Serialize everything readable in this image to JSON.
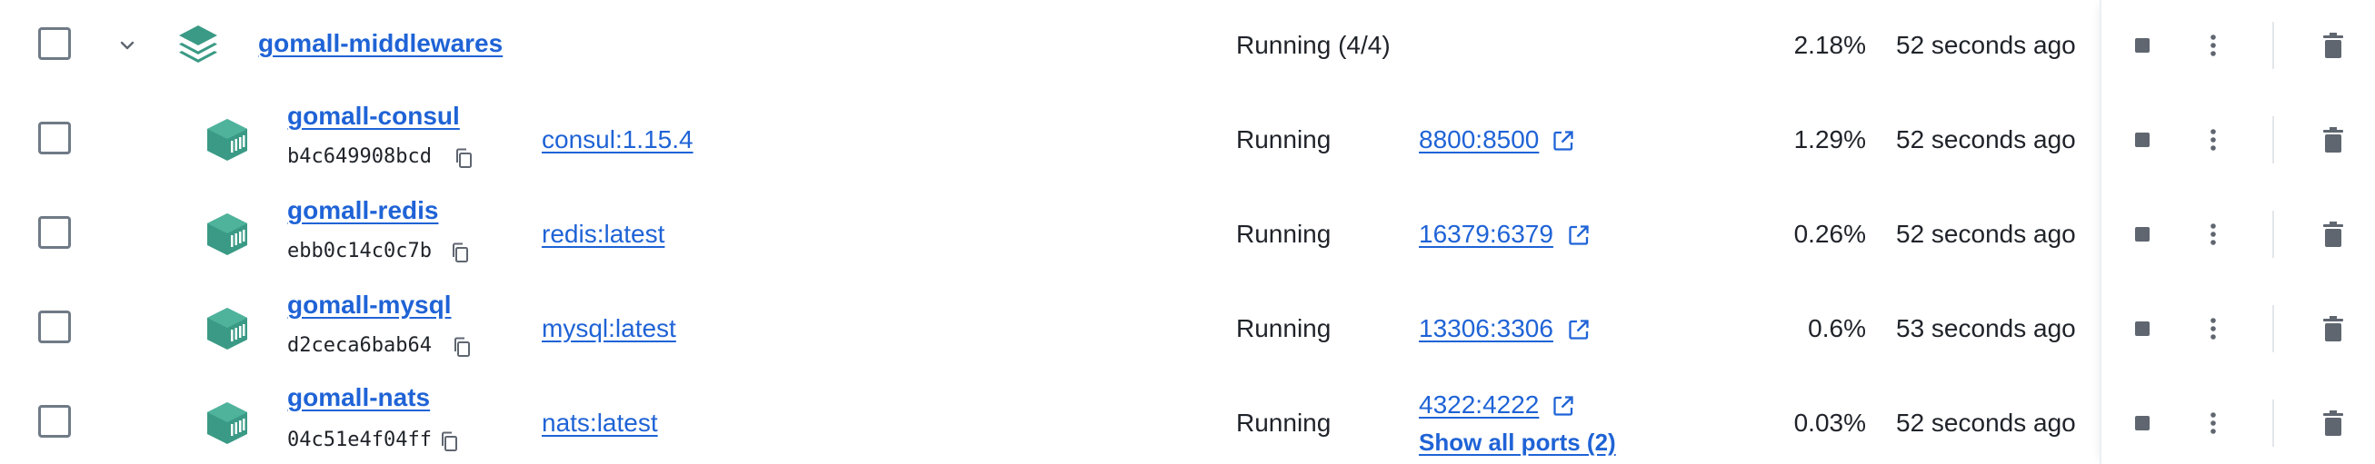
{
  "group": {
    "name": "gomall-middlewares",
    "status": "Running (4/4)",
    "cpu": "2.18%",
    "started": "52 seconds ago"
  },
  "containers": [
    {
      "name": "gomall-consul",
      "id": "b4c649908bcd",
      "image": "consul:1.15.4",
      "status": "Running",
      "port": "8800:8500",
      "cpu": "1.29%",
      "started": "52 seconds ago"
    },
    {
      "name": "gomall-redis",
      "id": "ebb0c14c0c7b",
      "image": "redis:latest",
      "status": "Running",
      "port": "16379:6379",
      "cpu": "0.26%",
      "started": "52 seconds ago"
    },
    {
      "name": "gomall-mysql",
      "id": "d2ceca6bab64",
      "image": "mysql:latest",
      "status": "Running",
      "port": "13306:3306",
      "cpu": "0.6%",
      "started": "53 seconds ago"
    },
    {
      "name": "gomall-nats",
      "id": "04c51e4f04ff",
      "image": "nats:latest",
      "status": "Running",
      "port": "4322:4222",
      "show_ports": "Show all ports (2)",
      "cpu": "0.03%",
      "started": "52 seconds ago"
    }
  ],
  "colors": {
    "link": "#1f63d6",
    "icon_green": "#3a9a85",
    "icon_gray": "#5f6670"
  },
  "icons": {
    "group": "stack-layers-icon",
    "container": "container-box-icon",
    "copy": "copy-icon",
    "external": "external-link-icon",
    "stop": "stop-icon",
    "more": "more-vertical-icon",
    "delete": "trash-icon",
    "collapse": "chevron-down-icon"
  }
}
